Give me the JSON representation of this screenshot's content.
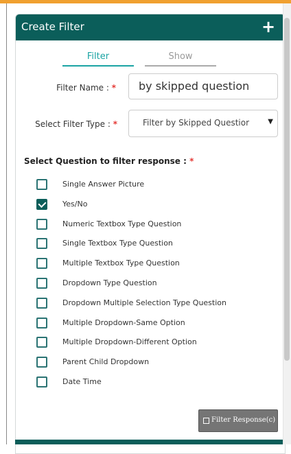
{
  "panel": {
    "title": "Create Filter",
    "add_icon": "plus-icon"
  },
  "tabs": [
    {
      "label": "Filter",
      "active": true
    },
    {
      "label": "Show",
      "active": false
    }
  ],
  "form": {
    "filter_name_label": "Filter Name :",
    "filter_name_value": "by skipped question",
    "filter_type_label": "Select Filter Type :",
    "filter_type_value": "Filter by Skipped Questior",
    "required_mark": "*",
    "question_label": "Select Question to filter response :"
  },
  "questions": [
    {
      "label": "Single Answer Picture",
      "checked": false
    },
    {
      "label": "Yes/No",
      "checked": true
    },
    {
      "label": "Numeric Textbox Type Question",
      "checked": false
    },
    {
      "label": "Single Textbox Type Question",
      "checked": false
    },
    {
      "label": "Multiple Textbox Type Question",
      "checked": false
    },
    {
      "label": "Dropdown Type Question",
      "checked": false
    },
    {
      "label": "Dropdown Multiple Selection Type Question",
      "checked": false
    },
    {
      "label": "Multiple Dropdown-Same Option",
      "checked": false
    },
    {
      "label": "Multiple Dropdown-Different Option",
      "checked": false
    },
    {
      "label": "Parent Child Dropdown",
      "checked": false
    },
    {
      "label": "Date Time",
      "checked": false
    }
  ],
  "actions": {
    "filter_button_label": "Filter Response(c)",
    "filter_button_icon": "save-icon"
  },
  "colors": {
    "header": "#0b5e5a",
    "tab_active": "#1aa3a3",
    "required": "#e53935"
  }
}
